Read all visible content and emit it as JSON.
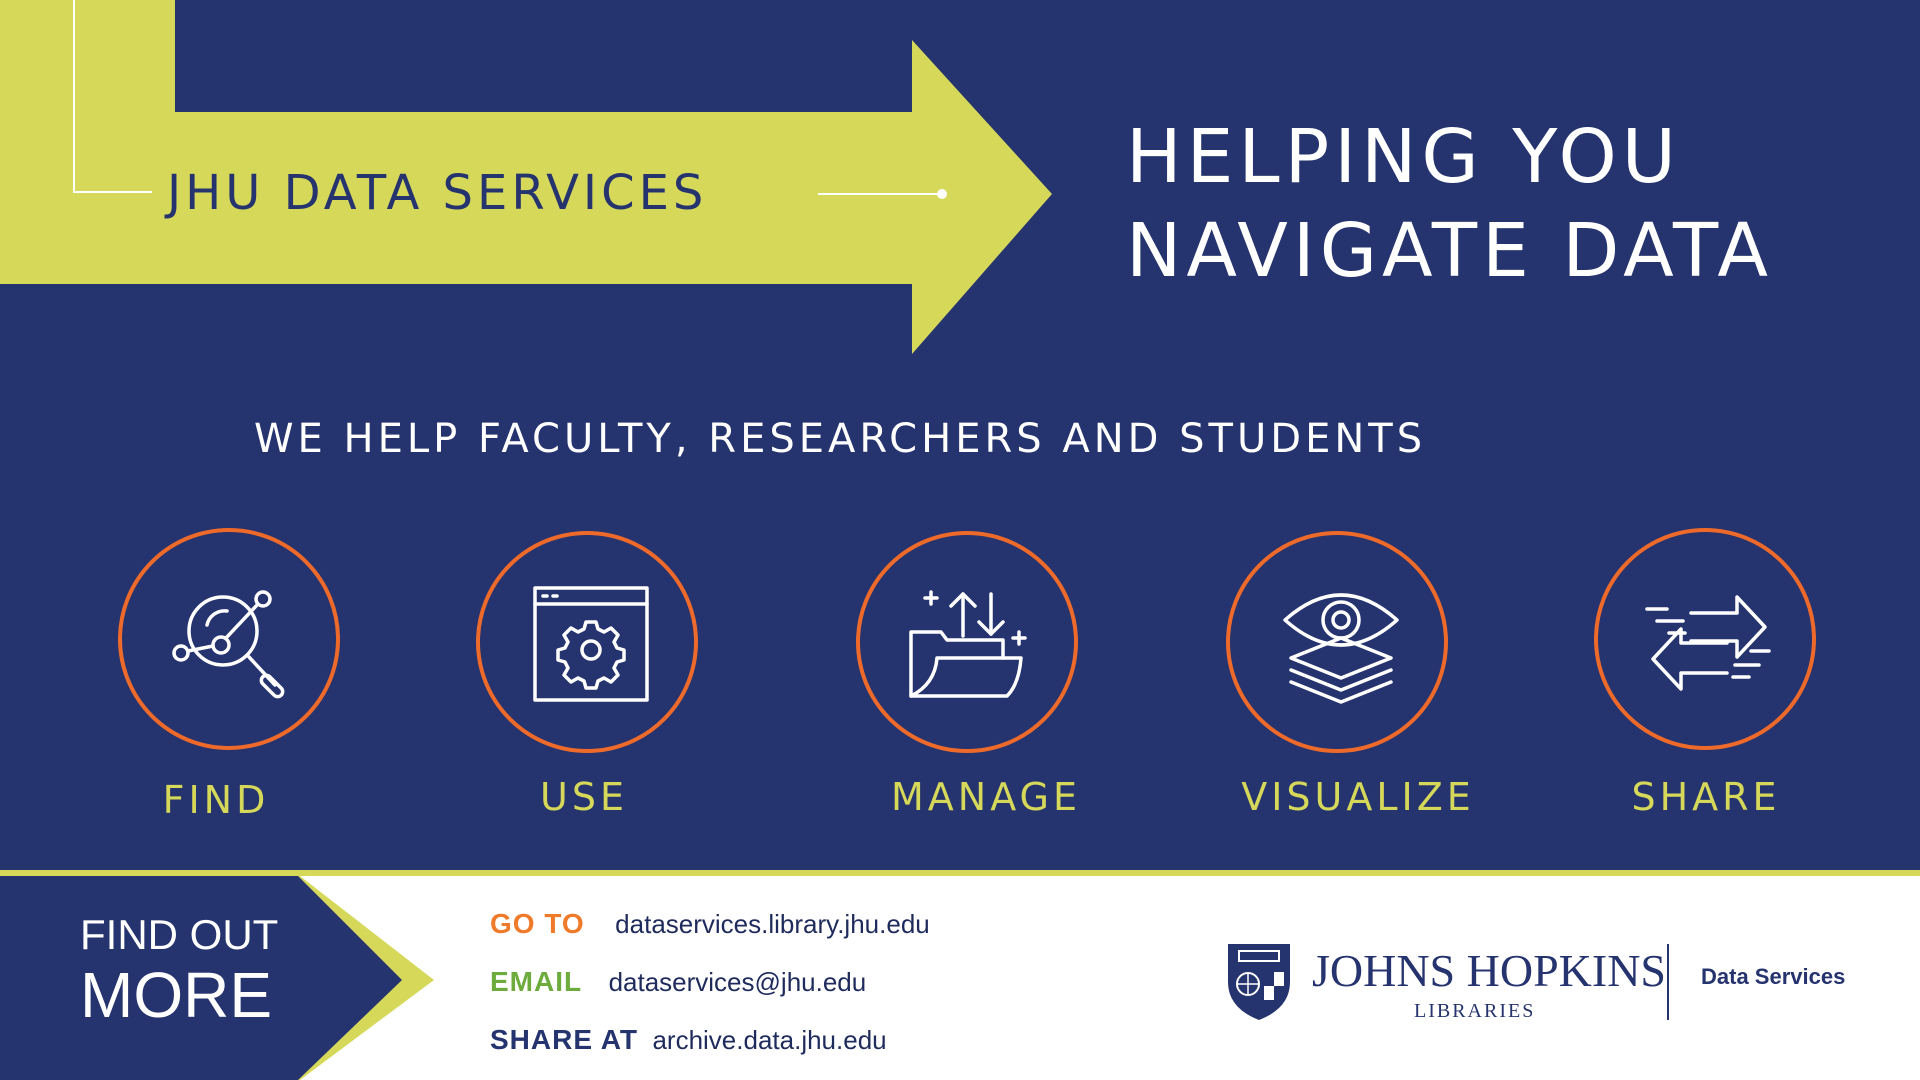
{
  "header": {
    "brand": "JHU DATA SERVICES",
    "headline_line1": "HELPING YOU",
    "headline_line2": "NAVIGATE DATA",
    "subhead": "WE HELP FACULTY, RESEARCHERS AND STUDENTS"
  },
  "services": [
    {
      "label": "FIND",
      "icon": "magnifier-network-icon"
    },
    {
      "label": "USE",
      "icon": "browser-gear-icon"
    },
    {
      "label": "MANAGE",
      "icon": "folder-transfer-icon"
    },
    {
      "label": "VISUALIZE",
      "icon": "eye-layers-icon"
    },
    {
      "label": "SHARE",
      "icon": "exchange-arrows-icon"
    }
  ],
  "footer": {
    "find_out_line1": "FIND OUT",
    "find_out_line2": "MORE",
    "contacts": [
      {
        "key": "GO TO",
        "value": "dataservices.library.jhu.edu"
      },
      {
        "key": "EMAIL",
        "value": "dataservices@jhu.edu"
      },
      {
        "key": "SHARE AT",
        "value": "archive.data.jhu.edu"
      }
    ],
    "logo_name": "JOHNS HOPKINS",
    "logo_sub": "LIBRARIES",
    "dept": "Data Services"
  },
  "colors": {
    "navy": "#25336e",
    "chartreuse": "#d6d85a",
    "orange": "#ee6a2a",
    "green": "#6cab3c"
  }
}
